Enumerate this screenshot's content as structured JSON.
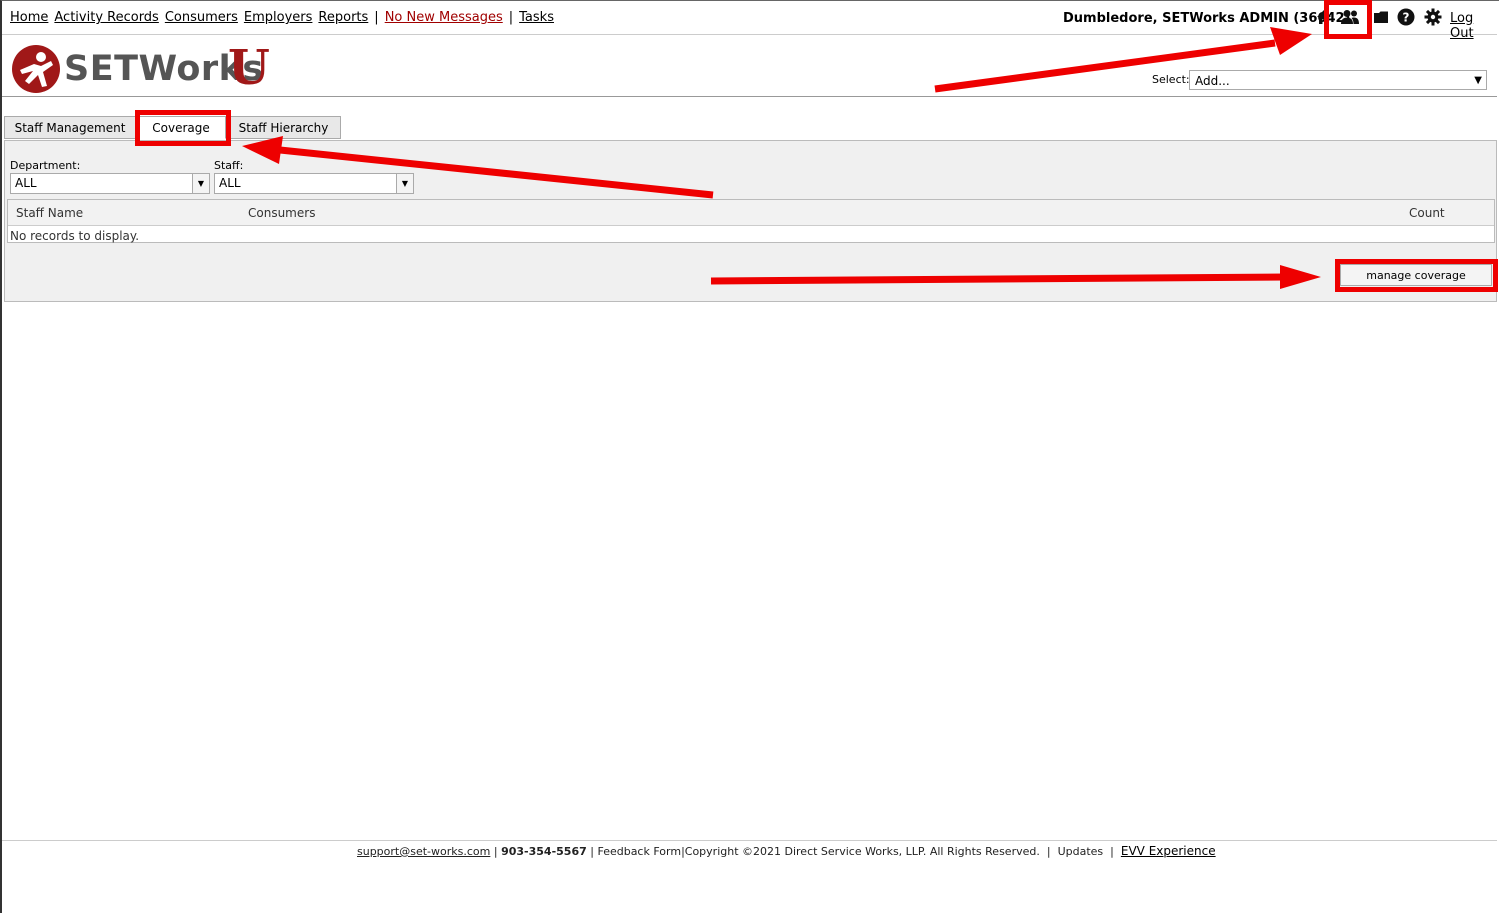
{
  "nav": {
    "links": [
      "Home",
      "Activity Records",
      "Consumers",
      "Employers",
      "Reports"
    ],
    "separator": "|",
    "messages": "No New Messages",
    "tasks": "Tasks",
    "user": "Dumbledore, SETWorks ADMIN  (36642)",
    "logout": "Log Out",
    "icons": [
      "home-icon",
      "staff-icon",
      "folder-icon",
      "help-icon",
      "gear-icon"
    ]
  },
  "logo": {
    "text": "SETWorks",
    "letter": "U",
    "accent": "#a01818"
  },
  "select": {
    "label": "Select:",
    "value": "Add..."
  },
  "tabs": [
    {
      "label": "Staff Management"
    },
    {
      "label": "Coverage",
      "active": true
    },
    {
      "label": "Staff Hierarchy"
    }
  ],
  "filters": {
    "department_label": "Department:",
    "department_value": "ALL",
    "staff_label": "Staff:",
    "staff_value": "ALL"
  },
  "grid": {
    "columns": [
      "Staff Name",
      "Consumers",
      "Count"
    ],
    "empty": "No records to display."
  },
  "manage_button": "manage coverage",
  "footer": {
    "email": "support@set-works.com",
    "sep": "|",
    "phone": "903-354-5567",
    "feedback": "Feedback Form",
    "copyright": "|Copyright ©2021 Direct Service Works, LLP. All Rights Reserved.",
    "updates": "Updates",
    "evv": "EVV Experience"
  },
  "annotation_color": "#ee0000"
}
